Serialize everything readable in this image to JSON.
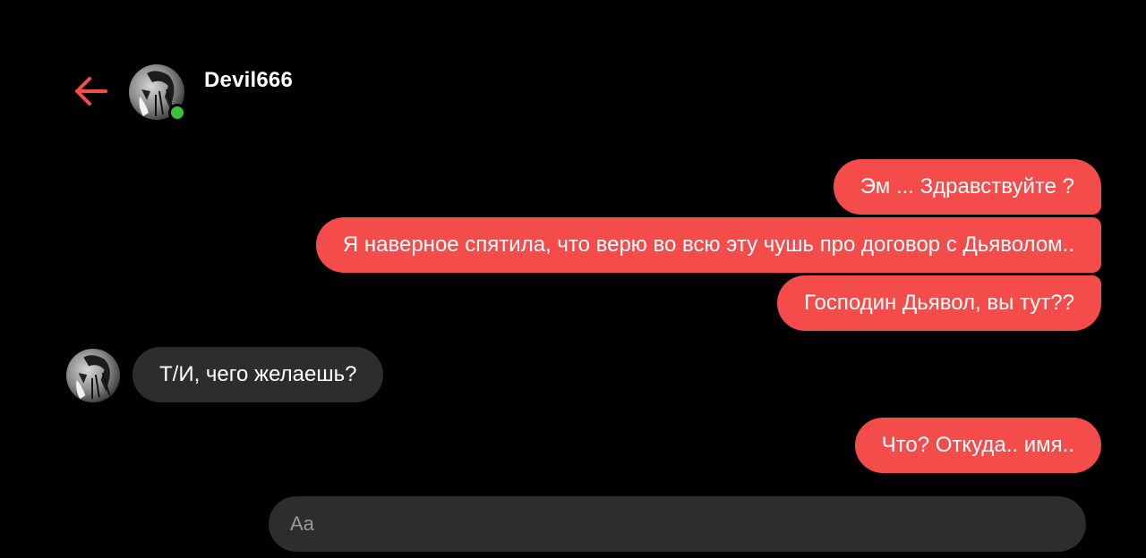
{
  "header": {
    "contact_name": "Devil666",
    "online": true,
    "back_icon": "arrow-left-icon",
    "accent_color": "#f44b4b",
    "online_color": "#3ac13a"
  },
  "messages": [
    {
      "direction": "outgoing",
      "text": "Эм ... Здравствуйте ?"
    },
    {
      "direction": "outgoing",
      "text": "Я наверное спятила, что верю во всю эту чушь про договор с Дьяволом.."
    },
    {
      "direction": "outgoing",
      "text": "Господин Дьявол, вы тут??"
    },
    {
      "direction": "incoming",
      "text": "Т/И, чего желаешь?"
    },
    {
      "direction": "outgoing",
      "text": "Что? Откуда.. имя.."
    }
  ],
  "composer": {
    "placeholder": "Aa",
    "value": ""
  },
  "colors": {
    "background": "#000000",
    "outgoing_bubble": "#f44b4b",
    "incoming_bubble": "#2d2d2f"
  }
}
